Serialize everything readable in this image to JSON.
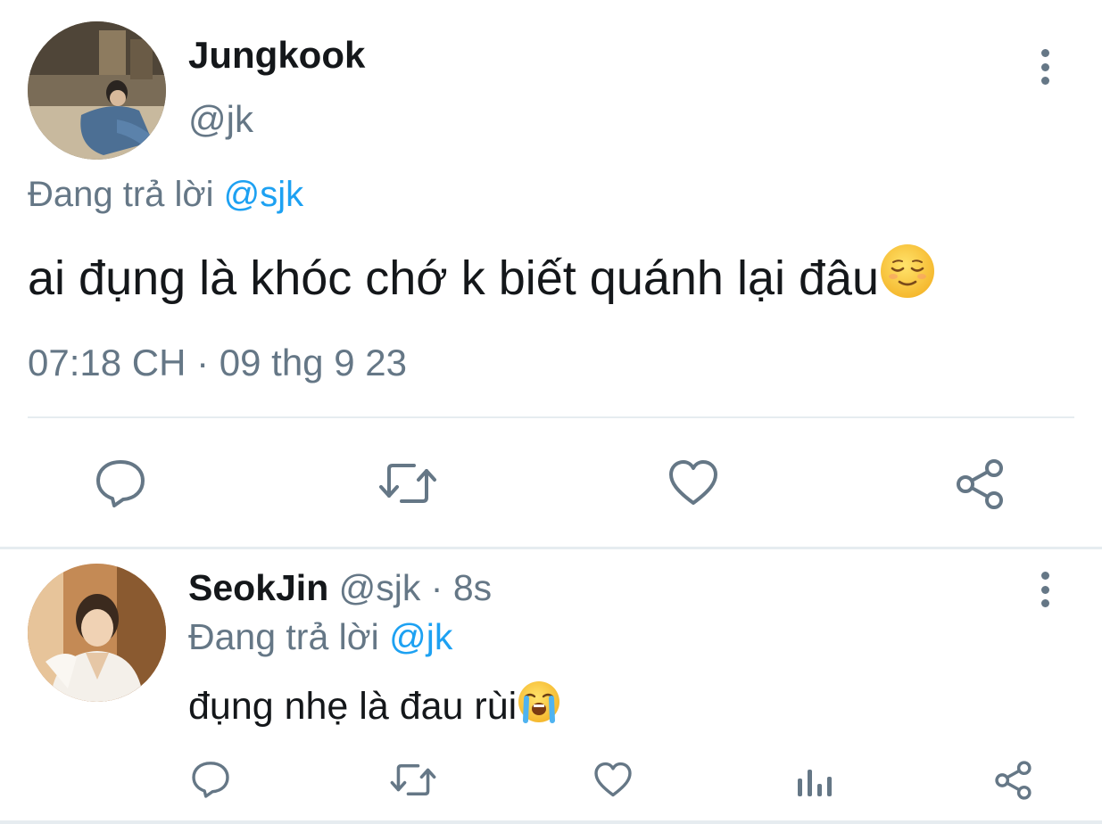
{
  "main_tweet": {
    "display_name": "Jungkook",
    "handle": "@jk",
    "replying_prefix": "Đang trả lời",
    "replying_to": "@sjk",
    "text": "ai đụng là khóc chớ k biết quánh lại đâu",
    "text_emoji": "relieved-face",
    "timestamp": "07:18 CH · 09 thg 9 23",
    "actions": [
      "reply-icon",
      "retweet-icon",
      "like-icon",
      "share-icon"
    ]
  },
  "reply_tweet": {
    "display_name": "SeokJin",
    "handle": "@sjk",
    "separator": " · ",
    "time_ago": "8s",
    "replying_prefix": "Đang trả lời",
    "replying_to": "@jk",
    "text": "đụng nhẹ là đau rùi",
    "text_emoji": "loudly-crying-face",
    "actions": [
      "reply-icon",
      "retweet-icon",
      "like-icon",
      "analytics-icon",
      "share-icon"
    ]
  },
  "colors": {
    "text_primary": "#14171a",
    "text_secondary": "#657786",
    "link": "#1da1f2",
    "divider": "#e6ecf0"
  }
}
